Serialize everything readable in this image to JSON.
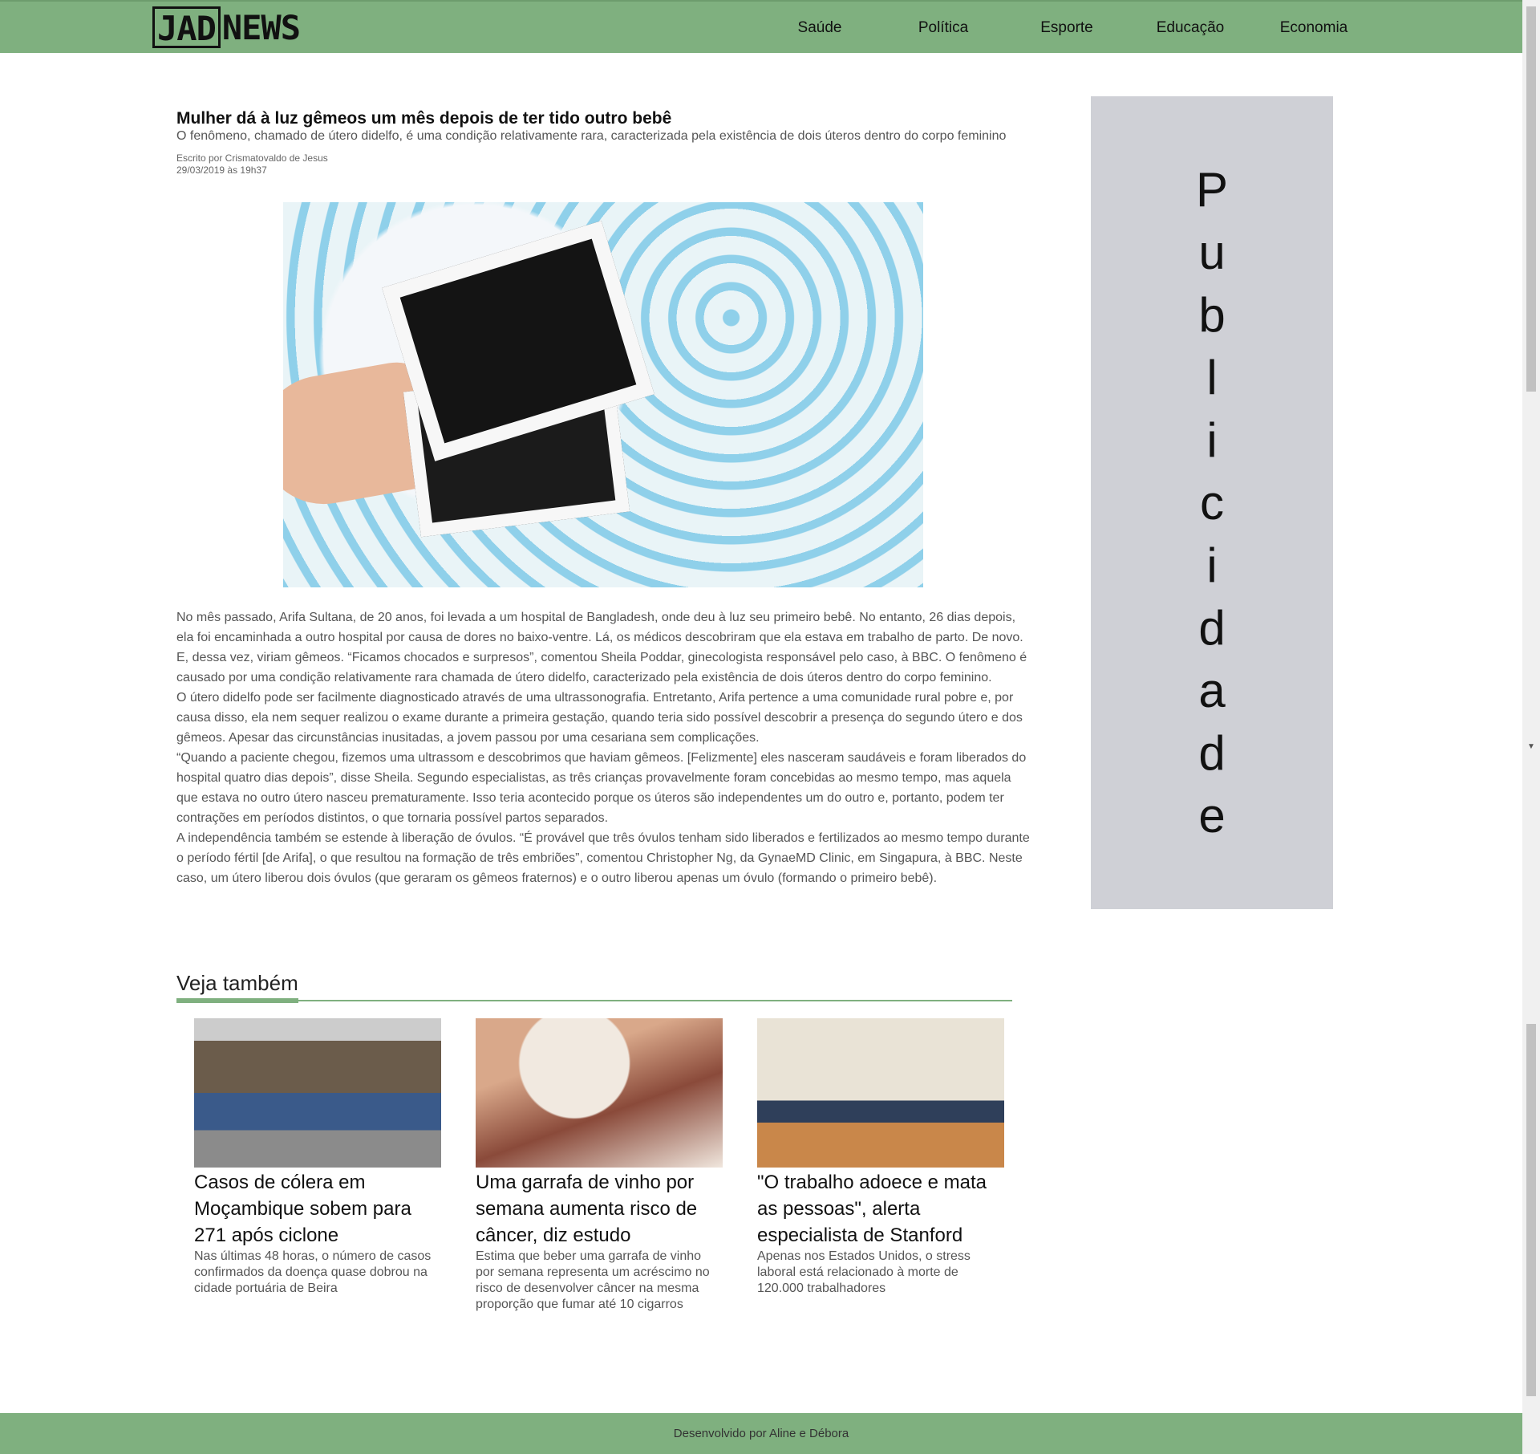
{
  "header": {
    "logo_boxed": "JAD",
    "logo_rest": "NEWS",
    "nav": [
      "Saúde",
      "Política",
      "Esporte",
      "Educação",
      "Economia"
    ]
  },
  "article": {
    "title": "Mulher dá à luz gêmeos um mês depois de ter tido outro bebê",
    "subtitle": "O fenômeno, chamado de útero didelfo, é uma condição relativamente rara, caracterizada pela existência de dois úteros dentro do corpo feminino",
    "author": "Escrito por Crismatovaldo de Jesus",
    "date": "29/03/2019 às 19h37",
    "paragraphs": [
      "No mês passado, Arifa Sultana, de 20 anos, foi levada a um hospital de Bangladesh, onde deu à luz seu primeiro bebê. No entanto, 26 dias depois, ela foi encaminhada a outro hospital por causa de dores no baixo-ventre. Lá, os médicos descobriram que ela estava em trabalho de parto. De novo. E, dessa vez, viriam gêmeos. “Ficamos chocados e surpresos”, comentou Sheila Poddar, ginecologista responsável pelo caso, à BBC. O fenômeno é causado por uma condição relativamente rara chamada de útero didelfo, caracterizado pela existência de dois úteros dentro do corpo feminino.",
      "O útero didelfo pode ser facilmente diagnosticado através de uma ultrassonografia. Entretanto, Arifa pertence a uma comunidade rural pobre e, por causa disso, ela nem sequer realizou o exame durante a primeira gestação, quando teria sido possível descobrir a presença do segundo útero e dos gêmeos. Apesar das circunstâncias inusitadas, a jovem passou por uma cesariana sem complicações.",
      "“Quando a paciente chegou, fizemos uma ultrassom e descobrimos que haviam gêmeos. [Felizmente] eles nasceram saudáveis e foram liberados do hospital quatro dias depois”, disse Sheila. Segundo especialistas, as três crianças provavelmente foram concebidas ao mesmo tempo, mas aquela que estava no outro útero nasceu prematuramente. Isso teria acontecido porque os úteros são independentes um do outro e, portanto, podem ter contrações em períodos distintos, o que tornaria possível partos separados.",
      "A independência também se estende à liberação de óvulos. “É provável que três óvulos tenham sido liberados e fertilizados ao mesmo tempo durante o período fértil [de Arifa], o que resultou na formação de três embriões”, comentou Christopher Ng, da GynaeMD Clinic, em Singapura, à BBC. Neste caso, um útero liberou dois óvulos (que geraram os gêmeos fraternos) e o outro liberou apenas um óvulo (formando o primeiro bebê)."
    ]
  },
  "ad": {
    "label": "Publicidade"
  },
  "see_also": {
    "title": "Veja também",
    "cards": [
      {
        "headline": "Casos de cólera em Moçambique sobem para 271 após ciclone",
        "summary": "Nas últimas 48 horas, o número de casos confirmados da doença quase dobrou na cidade portuária de Beira"
      },
      {
        "headline": "Uma garrafa de vinho por semana aumenta risco de câncer, diz estudo",
        "summary": "Estima que beber uma garrafa de vinho por semana representa um acréscimo no risco de desenvolver câncer na mesma proporção que fumar até 10 cigarros"
      },
      {
        "headline": "\"O trabalho adoece e mata as pessoas\", alerta especialista de Stanford",
        "summary": "Apenas nos Estados Unidos, o stress laboral está relacionado à morte de 120.000 trabalhadores"
      }
    ]
  },
  "footer": {
    "text": "Desenvolvido por Aline e Débora"
  },
  "colors": {
    "brand_green": "#7fb07f",
    "ad_gray": "#cfd0d6"
  }
}
